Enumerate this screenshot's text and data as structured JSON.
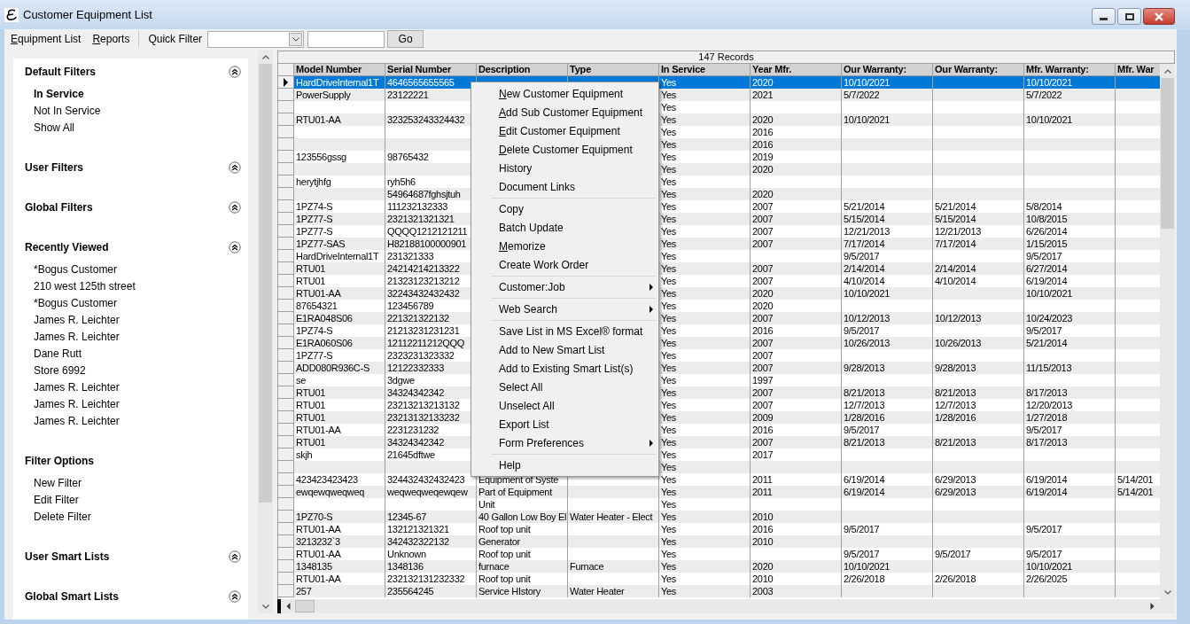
{
  "window": {
    "title": "Customer Equipment List"
  },
  "menu_bar": [
    {
      "label": "Equipment List",
      "underlined_first_letter": true
    },
    {
      "label": "Reports",
      "underlined_first_letter": true
    }
  ],
  "quick_filter": {
    "label": "Quick Filter",
    "button": "Go"
  },
  "sidebar": {
    "sections": [
      {
        "title": "Default Filters",
        "collapse_button": true,
        "items": [
          {
            "label": "In Service",
            "selected": true
          },
          {
            "label": "Not In Service",
            "selected": false
          },
          {
            "label": "Show All",
            "selected": false
          }
        ]
      },
      {
        "title": "User Filters",
        "collapse_button": true
      },
      {
        "title": "Global Filters",
        "collapse_button": true
      },
      {
        "title": "Recently Viewed",
        "collapse_button": true,
        "items": [
          {
            "label": "*Bogus Customer"
          },
          {
            "label": "210 west 125th street"
          },
          {
            "label": "*Bogus Customer"
          },
          {
            "label": "James R. Leichter"
          },
          {
            "label": "James R. Leichter"
          },
          {
            "label": "Dane Rutt"
          },
          {
            "label": "Store 6992"
          },
          {
            "label": "James R. Leichter"
          },
          {
            "label": "James R. Leichter"
          },
          {
            "label": "James R. Leichter"
          }
        ]
      },
      {
        "title": "Filter Options",
        "collapse_button": false,
        "items": [
          {
            "label": "New Filter"
          },
          {
            "label": "Edit Filter"
          },
          {
            "label": "Delete Filter"
          }
        ]
      },
      {
        "title": "User Smart Lists",
        "collapse_button": true
      },
      {
        "title": "Global Smart Lists",
        "collapse_button": true
      }
    ]
  },
  "table": {
    "record_count": "147 Records",
    "columns": [
      "Model Number",
      "Serial Number",
      "Description",
      "Type",
      "In Service",
      "Year Mfr.",
      "Our Warranty:",
      "Our Warranty:",
      "Mfr. Warranty:",
      "Mfr. War"
    ],
    "rows": [
      {
        "selected": true,
        "cells": [
          "HardDriveInternal1T",
          "4646565655565",
          null,
          null,
          "Yes",
          "2020",
          "10/10/2021",
          null,
          "10/10/2021",
          null
        ]
      },
      {
        "selected": false,
        "cells": [
          "PowerSupply",
          "23122221",
          null,
          null,
          "Yes",
          "2021",
          "5/7/2022",
          null,
          "5/7/2022",
          null
        ]
      },
      {
        "selected": false,
        "cells": [
          null,
          null,
          null,
          null,
          "Yes",
          null,
          null,
          null,
          null,
          null
        ]
      },
      {
        "selected": false,
        "cells": [
          "RTU01-AA",
          "323253243324432",
          null,
          null,
          "Yes",
          "2020",
          "10/10/2021",
          null,
          "10/10/2021",
          null
        ]
      },
      {
        "selected": false,
        "cells": [
          null,
          null,
          null,
          null,
          "Yes",
          "2016",
          null,
          null,
          null,
          null
        ]
      },
      {
        "selected": false,
        "cells": [
          null,
          null,
          null,
          null,
          "Yes",
          "2016",
          null,
          null,
          null,
          null
        ]
      },
      {
        "selected": false,
        "cells": [
          "123556gssg",
          "98765432",
          null,
          null,
          "Yes",
          "2019",
          null,
          null,
          null,
          null
        ]
      },
      {
        "selected": false,
        "cells": [
          null,
          null,
          null,
          null,
          "Yes",
          "2020",
          null,
          null,
          null,
          null
        ]
      },
      {
        "selected": false,
        "cells": [
          "herytjhfg",
          "ryh5h6",
          null,
          null,
          "Yes",
          null,
          null,
          null,
          null,
          null
        ]
      },
      {
        "selected": false,
        "cells": [
          null,
          "54964687fghsjtuh",
          null,
          null,
          "Yes",
          "2020",
          null,
          null,
          null,
          null
        ]
      },
      {
        "selected": false,
        "cells": [
          "1PZ74-S",
          "111232132333",
          null,
          null,
          "Yes",
          "2007",
          "5/21/2014",
          "5/21/2014",
          "5/8/2014",
          null
        ]
      },
      {
        "selected": false,
        "cells": [
          "1PZ77-S",
          "2321321321321",
          null,
          null,
          "Yes",
          "2007",
          "5/15/2014",
          "5/15/2014",
          "10/8/2015",
          null
        ]
      },
      {
        "selected": false,
        "cells": [
          "1PZ77-S",
          "QQQQ1212121211",
          null,
          null,
          "Yes",
          "2007",
          "12/21/2013",
          "12/21/2013",
          "6/26/2014",
          null
        ]
      },
      {
        "selected": false,
        "cells": [
          "1PZ77-SAS",
          "H82188100000901",
          null,
          null,
          "Yes",
          "2007",
          "7/17/2014",
          "7/17/2014",
          "1/15/2015",
          null
        ]
      },
      {
        "selected": false,
        "cells": [
          "HardDriveInternal1T",
          "231321333",
          null,
          null,
          "Yes",
          null,
          "9/5/2017",
          null,
          "9/5/2017",
          null
        ]
      },
      {
        "selected": false,
        "cells": [
          "RTU01",
          "24214214213322",
          null,
          null,
          "Yes",
          "2007",
          "2/14/2014",
          "2/14/2014",
          "6/27/2014",
          null
        ]
      },
      {
        "selected": false,
        "cells": [
          "RTU01",
          "21323123213212",
          null,
          null,
          "Yes",
          "2007",
          "4/10/2014",
          "4/10/2014",
          "6/19/2014",
          null
        ]
      },
      {
        "selected": false,
        "cells": [
          "RTU01-AA",
          "32243432432432",
          null,
          null,
          "Yes",
          "2020",
          "10/10/2021",
          null,
          "10/10/2021",
          null
        ]
      },
      {
        "selected": false,
        "cells": [
          "87654321",
          "123456789",
          null,
          null,
          "Yes",
          "2020",
          null,
          null,
          null,
          null
        ]
      },
      {
        "selected": false,
        "cells": [
          "E1RA048S06",
          "221321322132",
          null,
          null,
          "Yes",
          "2007",
          "10/12/2013",
          "10/12/2013",
          "10/24/2023",
          null
        ]
      },
      {
        "selected": false,
        "cells": [
          "1PZ74-S",
          "21213231231231",
          null,
          null,
          "Yes",
          "2016",
          "9/5/2017",
          null,
          "9/5/2017",
          null
        ]
      },
      {
        "selected": false,
        "cells": [
          "E1RA060S06",
          "12112211212QQQ",
          null,
          null,
          "Yes",
          "2007",
          "10/26/2013",
          "10/26/2013",
          "5/21/2014",
          null
        ]
      },
      {
        "selected": false,
        "cells": [
          "1PZ77-S",
          "2323231323332",
          null,
          null,
          "Yes",
          "2007",
          null,
          null,
          null,
          null
        ]
      },
      {
        "selected": false,
        "cells": [
          "ADD080R936C-S",
          "12122332333",
          null,
          null,
          "Yes",
          "2007",
          "9/28/2013",
          "9/28/2013",
          "11/15/2013",
          null
        ]
      },
      {
        "selected": false,
        "cells": [
          "se",
          "3dgwe",
          null,
          null,
          "Yes",
          "1997",
          null,
          null,
          null,
          null
        ]
      },
      {
        "selected": false,
        "cells": [
          "RTU01",
          "34324342342",
          null,
          null,
          "Yes",
          "2007",
          "8/21/2013",
          "8/21/2013",
          "8/17/2013",
          null
        ]
      },
      {
        "selected": false,
        "cells": [
          "RTU01",
          "23213213213132",
          null,
          null,
          "Yes",
          "2007",
          "12/7/2013",
          "12/7/2013",
          "12/20/2013",
          null
        ]
      },
      {
        "selected": false,
        "cells": [
          "RTU01",
          "23213132133232",
          null,
          null,
          "Yes",
          "2009",
          "1/28/2016",
          "1/28/2016",
          "1/27/2018",
          null
        ]
      },
      {
        "selected": false,
        "cells": [
          "RTU01-AA",
          "2231231232",
          null,
          null,
          "Yes",
          "2016",
          "9/5/2017",
          null,
          "9/5/2017",
          null
        ]
      },
      {
        "selected": false,
        "cells": [
          "RTU01",
          "34324342342",
          null,
          null,
          "Yes",
          "2007",
          "8/21/2013",
          "8/21/2013",
          "8/17/2013",
          null
        ]
      },
      {
        "selected": false,
        "cells": [
          "skjh",
          "21645dftwe",
          null,
          null,
          "Yes",
          "2017",
          null,
          null,
          null,
          null
        ]
      },
      {
        "selected": false,
        "cells": [
          null,
          null,
          null,
          null,
          "Yes",
          null,
          null,
          null,
          null,
          null
        ]
      },
      {
        "selected": false,
        "cells": [
          "423423423423",
          "324432432432423",
          "Equipment of Syste",
          null,
          "Yes",
          "2011",
          "6/19/2014",
          "6/29/2013",
          "6/19/2014",
          "5/14/201"
        ]
      },
      {
        "selected": false,
        "cells": [
          "ewqewqweqweq",
          "weqweqweqewqew",
          "Part of Equipment",
          null,
          "Yes",
          "2011",
          "6/19/2014",
          "6/29/2013",
          "6/19/2014",
          "5/14/201"
        ]
      },
      {
        "selected": false,
        "cells": [
          null,
          null,
          "Unit",
          null,
          "Yes",
          null,
          null,
          null,
          null,
          null
        ]
      },
      {
        "selected": false,
        "cells": [
          "1PZ70-S",
          "12345-67",
          "40 Gallon Low Boy El",
          "Water Heater - Elect",
          "Yes",
          "2010",
          null,
          null,
          null,
          null
        ]
      },
      {
        "selected": false,
        "cells": [
          "RTU01-AA",
          "132121321321",
          "Roof top unit",
          null,
          "Yes",
          "2016",
          "9/5/2017",
          null,
          "9/5/2017",
          null
        ]
      },
      {
        "selected": false,
        "cells": [
          "3213232`3",
          "342432322132",
          "Generator",
          null,
          "Yes",
          "2010",
          null,
          null,
          null,
          null
        ]
      },
      {
        "selected": false,
        "cells": [
          "RTU01-AA",
          "Unknown",
          "Roof top unit",
          null,
          "Yes",
          null,
          "9/5/2017",
          "9/5/2017",
          "9/5/2017",
          null
        ]
      },
      {
        "selected": false,
        "cells": [
          "1348135",
          "1348136",
          "furnace",
          "Furnace",
          "Yes",
          "2020",
          "10/10/2021",
          null,
          "10/10/2021",
          null
        ]
      },
      {
        "selected": false,
        "cells": [
          "RTU01-AA",
          "232132131232332",
          "Roof top unit",
          null,
          "Yes",
          "2010",
          "2/26/2018",
          "2/26/2018",
          "2/26/2025",
          null
        ]
      },
      {
        "selected": false,
        "cells": [
          "257",
          "235564245",
          "Service HIstory",
          "Water Heater",
          "Yes",
          "2003",
          null,
          null,
          null,
          null
        ]
      }
    ]
  },
  "context_menu": {
    "items": [
      {
        "kind": "item",
        "label": "New Customer Equipment",
        "underlined_first_letter": true,
        "submenu": false
      },
      {
        "kind": "item",
        "label": "Add Sub Customer Equipment",
        "underlined_first_letter": true,
        "submenu": false
      },
      {
        "kind": "item",
        "label": "Edit Customer Equipment",
        "underlined_first_letter": true,
        "submenu": false
      },
      {
        "kind": "item",
        "label": "Delete Customer Equipment",
        "underlined_first_letter": true,
        "submenu": false
      },
      {
        "kind": "item",
        "label": "History",
        "underlined_first_letter": false,
        "submenu": false
      },
      {
        "kind": "item",
        "label": "Document Links",
        "underlined_first_letter": false,
        "submenu": false
      },
      {
        "kind": "separator"
      },
      {
        "kind": "item",
        "label": "Copy",
        "underlined_first_letter": false,
        "submenu": false
      },
      {
        "kind": "item",
        "label": "Batch Update",
        "underlined_first_letter": false,
        "submenu": false
      },
      {
        "kind": "item",
        "label": "Memorize",
        "underlined_first_letter": true,
        "submenu": false
      },
      {
        "kind": "item",
        "label": "Create Work Order",
        "underlined_first_letter": false,
        "submenu": false
      },
      {
        "kind": "separator"
      },
      {
        "kind": "item",
        "label": "Customer:Job",
        "underlined_first_letter": false,
        "submenu": true
      },
      {
        "kind": "separator"
      },
      {
        "kind": "item",
        "label": "Web Search",
        "underlined_first_letter": false,
        "submenu": true
      },
      {
        "kind": "separator"
      },
      {
        "kind": "item",
        "label": "Save List in MS Excel® format",
        "underlined_first_letter": false,
        "submenu": false
      },
      {
        "kind": "item",
        "label": "Add to New Smart List",
        "underlined_first_letter": false,
        "submenu": false
      },
      {
        "kind": "item",
        "label": "Add to Existing Smart List(s)",
        "underlined_first_letter": false,
        "submenu": false
      },
      {
        "kind": "item",
        "label": "Select All",
        "underlined_first_letter": false,
        "submenu": false
      },
      {
        "kind": "item",
        "label": "Unselect All",
        "underlined_first_letter": false,
        "submenu": false
      },
      {
        "kind": "item",
        "label": "Export List",
        "underlined_first_letter": false,
        "submenu": false
      },
      {
        "kind": "item",
        "label": "Form Preferences",
        "underlined_first_letter": false,
        "submenu": true
      },
      {
        "kind": "separator"
      },
      {
        "kind": "item",
        "label": "Help",
        "underlined_first_letter": false,
        "submenu": false
      }
    ]
  }
}
